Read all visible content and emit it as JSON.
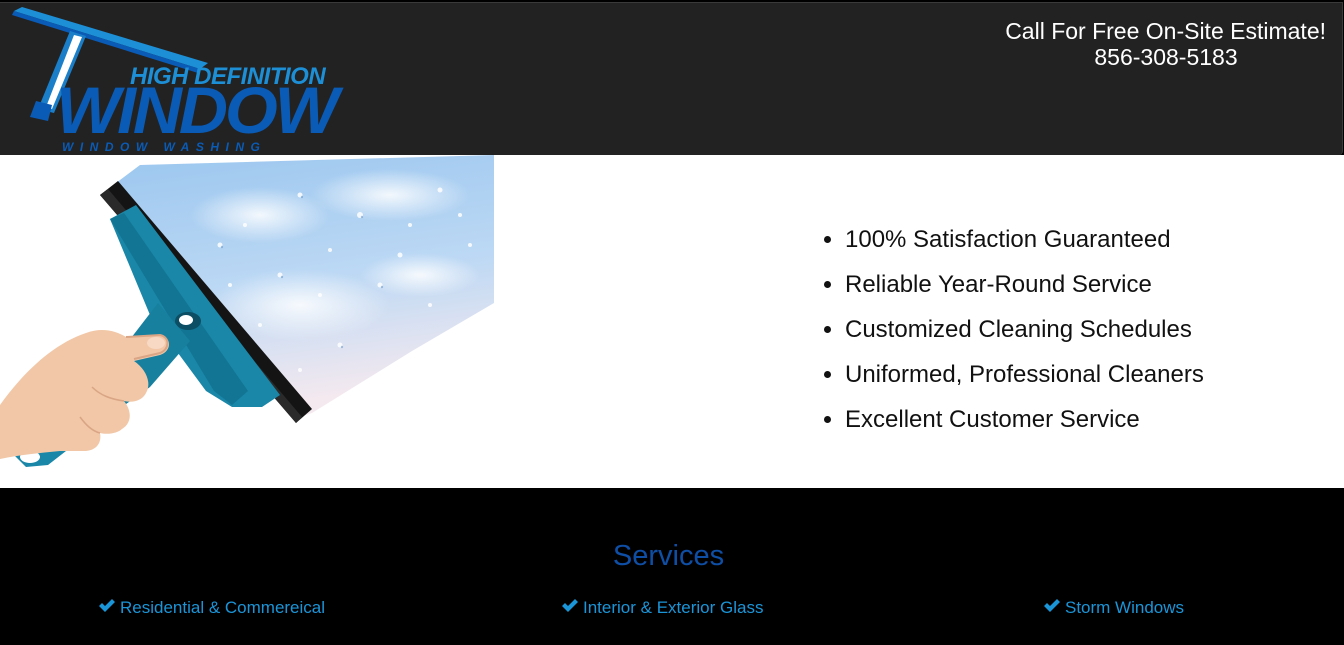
{
  "header": {
    "logo": {
      "top_text": "HIGH DEFINITION",
      "main_text": "WINDOW",
      "sub_text": "WINDOW WASHING",
      "icon": "squeegee-icon",
      "colors": {
        "light_blue": "#1d8fd6",
        "dark_blue": "#0a5bb6"
      }
    },
    "cta_line1": "Call For Free On-Site Estimate!",
    "cta_phone": "856-308-5183",
    "background": "#222222"
  },
  "hero": {
    "image": "hand-holding-squeegee-on-wet-glass",
    "features": [
      "100% Satisfaction Guaranteed",
      "Reliable Year-Round Service",
      "Customized Cleaning Schedules",
      "Uniformed, Professional Cleaners",
      "Excellent Customer Service"
    ]
  },
  "services": {
    "title": "Services",
    "title_color": "#0e4ea4",
    "item_color": "#1a95d8",
    "check_icon": "checkmark-icon",
    "items": [
      "Residential & Commereical",
      "Interior & Exterior Glass",
      "Storm Windows"
    ]
  }
}
